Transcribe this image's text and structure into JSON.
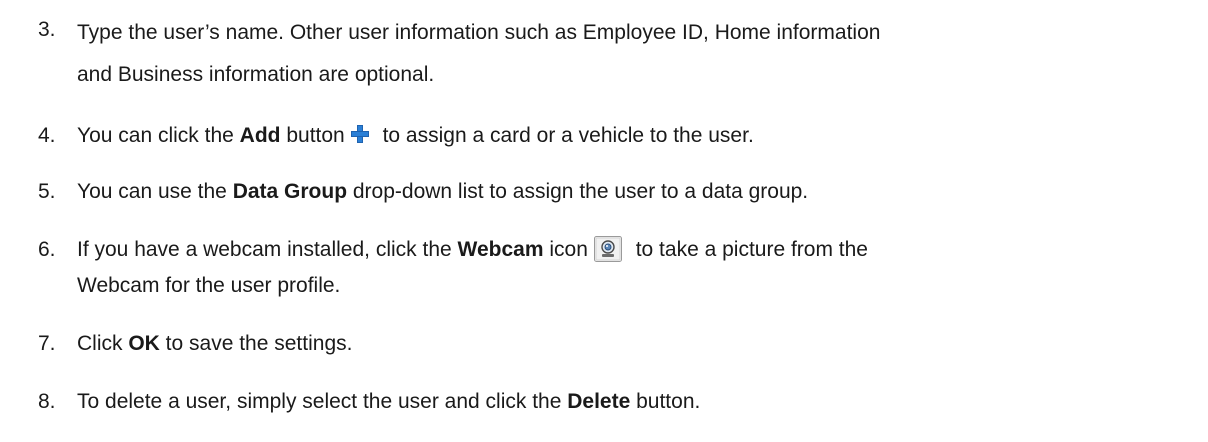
{
  "steps": [
    {
      "num": "3.",
      "line1": "Type the user’s name. Other user information such as Employee ID, Home information",
      "line2": "and Business information are optional."
    },
    {
      "num": "4.",
      "pre": "You can click the ",
      "bold": "Add",
      "mid": " button",
      "post": " to assign a card or a vehicle to the user.",
      "icon": "plus-icon"
    },
    {
      "num": "5.",
      "pre": "You can use the ",
      "bold": "Data Group",
      "post": " drop-down list to assign the user to a data group."
    },
    {
      "num": "6.",
      "pre": "If you have a webcam installed, click the ",
      "bold": "Webcam",
      "mid": " icon",
      "post": " to take a picture from the",
      "line2": "Webcam for the user profile.",
      "icon": "webcam-icon"
    },
    {
      "num": "7.",
      "pre": "Click ",
      "bold": "OK",
      "post": " to save the settings."
    },
    {
      "num": "8.",
      "pre": "To delete a user, simply select the user and click the ",
      "bold": "Delete",
      "post": " button."
    }
  ]
}
